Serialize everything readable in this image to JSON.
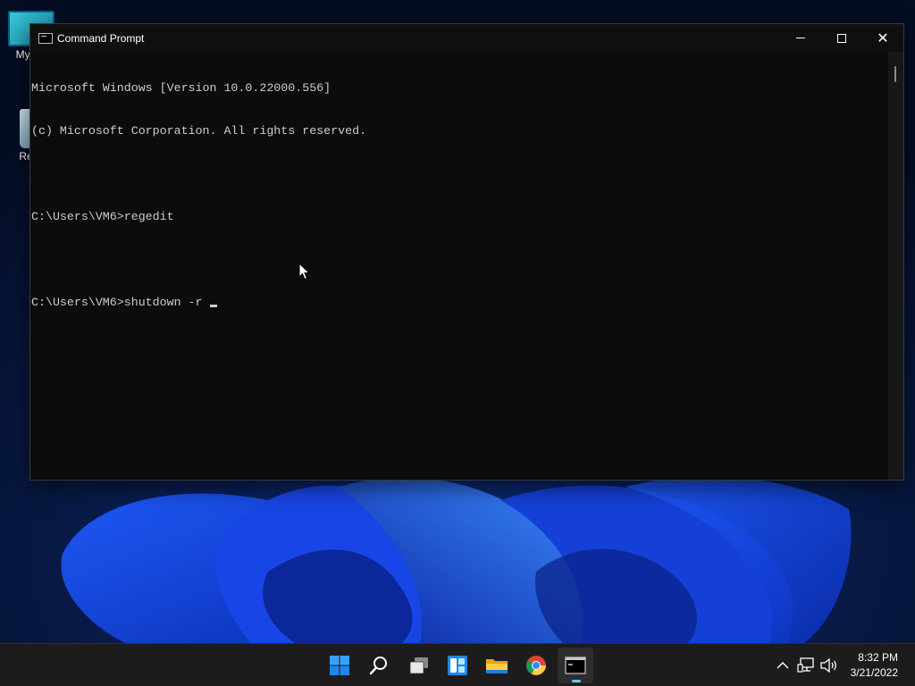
{
  "desktop": {
    "icons": [
      {
        "label": "My Co",
        "icon": "computer-icon"
      },
      {
        "label": "Recy",
        "icon": "recycle-bin-icon"
      }
    ]
  },
  "window": {
    "title": "Command Prompt",
    "app_icon": "console-icon",
    "controls": {
      "minimize": "minimize-icon",
      "maximize": "maximize-icon",
      "close": "close-icon"
    }
  },
  "console": {
    "lines": [
      "Microsoft Windows [Version 10.0.22000.556]",
      "(c) Microsoft Corporation. All rights reserved.",
      "",
      "C:\\Users\\VM6>regedit",
      "",
      "C:\\Users\\VM6>shutdown -r"
    ],
    "colors": {
      "background": "#0c0c0c",
      "text": "#cccccc"
    }
  },
  "taskbar": {
    "apps": [
      {
        "name": "start",
        "icon": "windows-logo-icon"
      },
      {
        "name": "search",
        "icon": "search-icon"
      },
      {
        "name": "task-view",
        "icon": "task-view-icon"
      },
      {
        "name": "widgets",
        "icon": "widgets-icon"
      },
      {
        "name": "file-explorer",
        "icon": "folder-icon"
      },
      {
        "name": "chrome",
        "icon": "chrome-icon"
      },
      {
        "name": "command-prompt",
        "icon": "terminal-icon",
        "active": true
      }
    ],
    "tray": {
      "icons": [
        "chevron-up-icon",
        "network-icon",
        "volume-icon"
      ],
      "time": "8:32 PM",
      "date": "3/21/2022"
    },
    "colors": {
      "background": "#1c1c1c",
      "accent": "#60cdff"
    }
  }
}
